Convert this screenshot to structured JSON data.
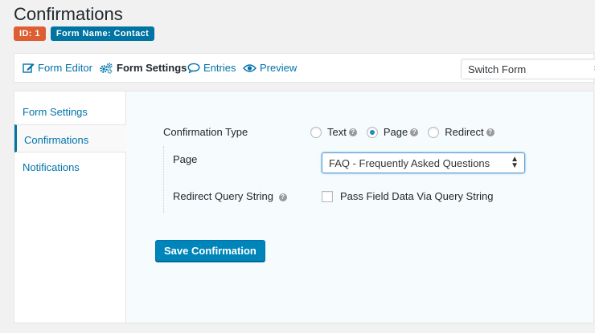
{
  "page": {
    "title": "Confirmations",
    "badges": {
      "id": "ID: 1",
      "form_name": "Form Name: Contact"
    }
  },
  "toolbar": {
    "form_editor": "Form Editor",
    "form_settings": "Form Settings",
    "entries": "Entries",
    "preview": "Preview",
    "switch_form": "Switch Form"
  },
  "sidebar": {
    "items": [
      {
        "label": "Form Settings",
        "active": false
      },
      {
        "label": "Confirmations",
        "active": true
      },
      {
        "label": "Notifications",
        "active": false
      }
    ]
  },
  "confirmation": {
    "type_label": "Confirmation Type",
    "options": [
      {
        "label": "Text",
        "checked": false
      },
      {
        "label": "Page",
        "checked": true
      },
      {
        "label": "Redirect",
        "checked": false
      }
    ],
    "page_label": "Page",
    "page_value": "FAQ - Frequently Asked Questions",
    "redirect_label": "Redirect Query String",
    "pass_field_label": "Pass Field Data Via Query String",
    "pass_field_checked": false,
    "save_label": "Save Confirmation"
  },
  "colors": {
    "accent": "#0074a2",
    "id_badge": "#dd5e33",
    "link": "#0073aa",
    "button": "#0085ba"
  }
}
